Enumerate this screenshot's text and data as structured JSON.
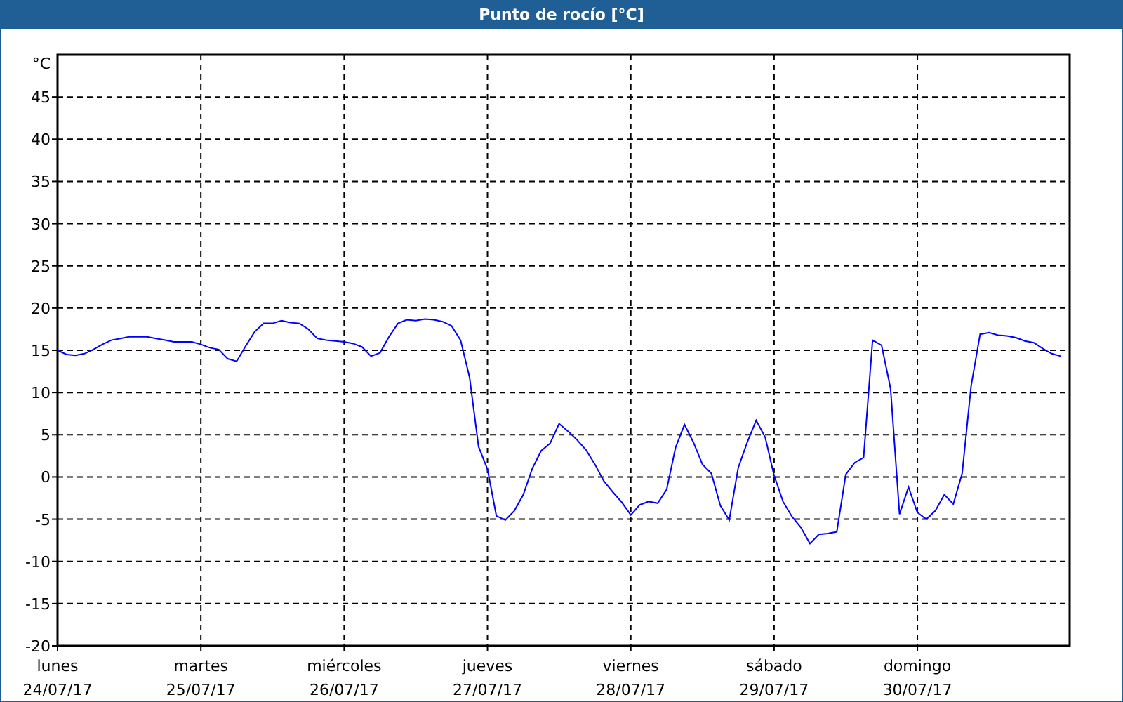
{
  "window": {
    "title": "Punto de rocío [°C]"
  },
  "chart": {
    "chart_data": {
      "type": "line",
      "grid": true,
      "ylabel": "°C",
      "ylim": [
        -20,
        50
      ],
      "yticks": [
        -20,
        -15,
        -10,
        -5,
        0,
        5,
        10,
        15,
        20,
        25,
        30,
        35,
        40,
        45
      ],
      "categories": [
        "24/07/17",
        null,
        null,
        null,
        null,
        null,
        null,
        null,
        null,
        null,
        null,
        null,
        null,
        null,
        null,
        null,
        "25/07/17",
        null,
        null,
        null,
        null,
        null,
        null,
        null,
        null,
        null,
        null,
        null,
        null,
        null,
        null,
        null,
        "26/07/17",
        null,
        null,
        null,
        null,
        null,
        null,
        null,
        null,
        null,
        null,
        null,
        null,
        null,
        null,
        null,
        "27/07/17",
        null,
        null,
        null,
        null,
        null,
        null,
        null,
        null,
        null,
        null,
        null,
        null,
        null,
        null,
        null,
        "28/07/17",
        null,
        null,
        null,
        null,
        null,
        null,
        null,
        null,
        null,
        null,
        null,
        null,
        null,
        null,
        null,
        "29/07/17",
        null,
        null,
        null,
        null,
        null,
        null,
        null,
        null,
        null,
        null,
        null,
        null,
        null,
        null,
        null,
        "30/07/17",
        null,
        null,
        null,
        null,
        null,
        null,
        null,
        null,
        null,
        null,
        null,
        null,
        null,
        null,
        null,
        null
      ],
      "series": [
        {
          "color": "#0000ff",
          "values": [
            15,
            14.5,
            14.4,
            14.6,
            15.1,
            15.7,
            16.2,
            16.4,
            16.6,
            16.6,
            16.6,
            16.4,
            16.2,
            16,
            16,
            16,
            15.7,
            15.3,
            15.1,
            14,
            13.7,
            15.5,
            17.2,
            18.2,
            18.2,
            18.5,
            18.3,
            18.2,
            17.5,
            16.4,
            16.2,
            16.1,
            16,
            15.8,
            15.4,
            14.3,
            14.7,
            16.6,
            18.2,
            18.6,
            18.5,
            18.7,
            18.6,
            18.4,
            17.9,
            16.2,
            11.8,
            3.6,
            0.9,
            -4.6,
            -5.1,
            -4,
            -2.1,
            1,
            3.1,
            4,
            6.3,
            5.4,
            4.4,
            3.2,
            1.5,
            -0.5,
            -1.8,
            -3,
            -4.5,
            -3.3,
            -2.9,
            -3.1,
            -1.5,
            3.5,
            6.2,
            4.1,
            1.5,
            0.4,
            -3.4,
            -5.1,
            1.1,
            4.1,
            6.7,
            4.7,
            0.2,
            -2.9,
            -4.7,
            -6,
            -7.9,
            -6.8,
            -6.7,
            -6.5,
            0.3,
            1.7,
            2.3,
            16.2,
            15.6,
            10.5,
            -4.4,
            -1.2,
            -4.2,
            -5,
            -4,
            -2.1,
            -3.2,
            0.4,
            10.8,
            16.9,
            17.1,
            16.8,
            16.7,
            16.5,
            16.1,
            15.9,
            15.2,
            14.6,
            14.3
          ]
        }
      ]
    },
    "x_day_names": [
      "lunes",
      "martes",
      "miércoles",
      "jueves",
      "viernes",
      "sábado",
      "domingo"
    ]
  }
}
